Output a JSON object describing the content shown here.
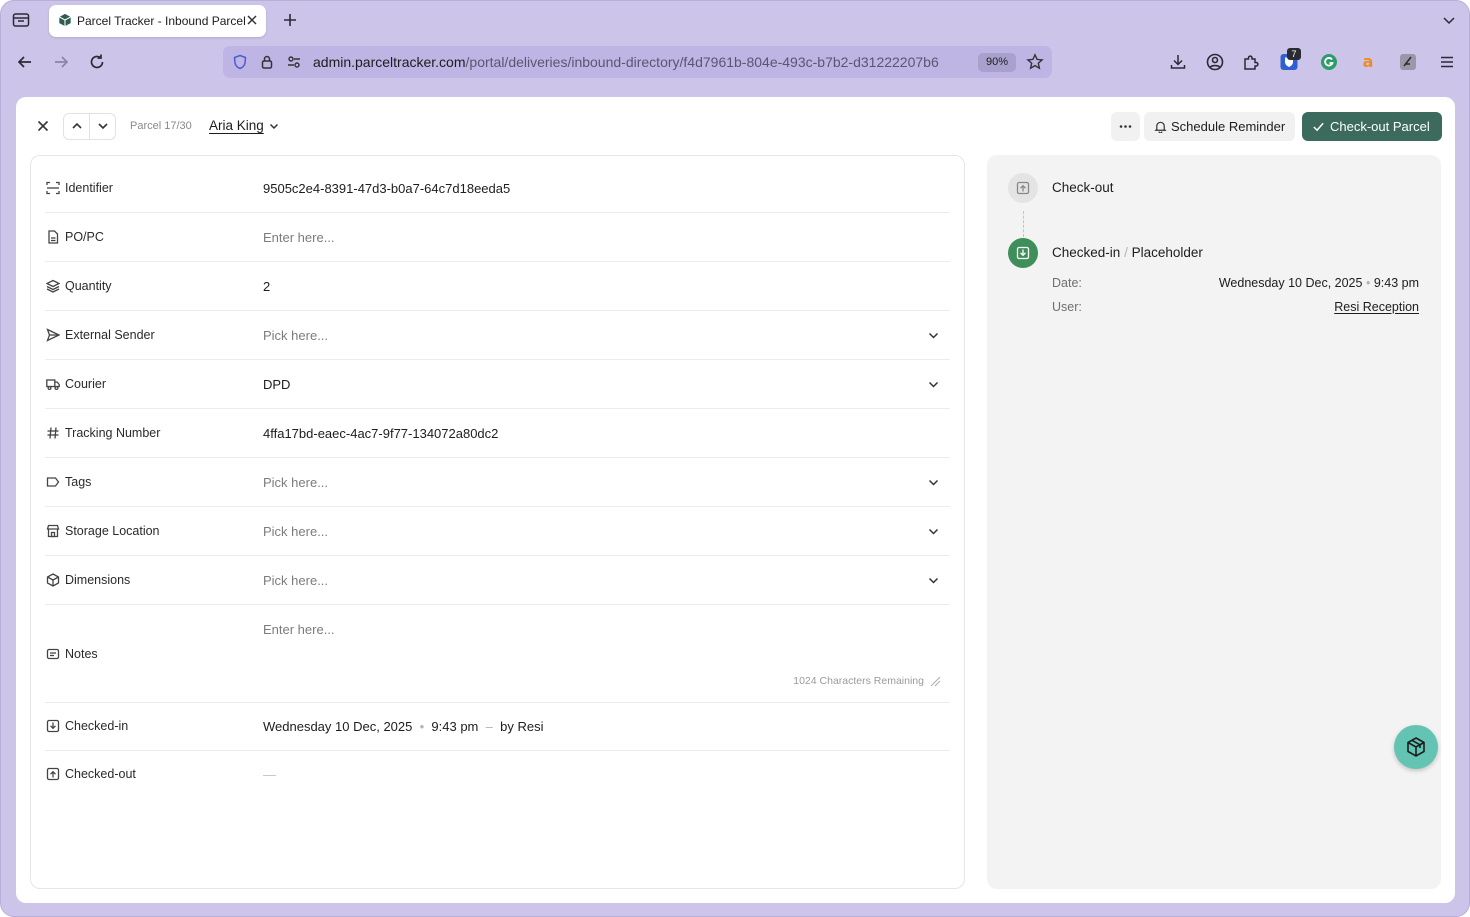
{
  "browser": {
    "tab_title": "Parcel Tracker - Inbound Parcels",
    "url_host": "admin.parceltracker.com",
    "url_path": "/portal/deliveries/inbound-directory/f4d7961b-804e-493c-b7b2-d31222207b6",
    "zoom": "90%",
    "extension_badge": "7"
  },
  "header": {
    "parcel_position": "Parcel 17/30",
    "recipient": "Aria King",
    "schedule_label": "Schedule Reminder",
    "checkout_label": "Check-out Parcel"
  },
  "form": {
    "identifier": {
      "label": "Identifier",
      "value": "9505c2e4-8391-47d3-b0a7-64c7d18eeda5"
    },
    "po_pc": {
      "label": "PO/PC",
      "placeholder": "Enter here..."
    },
    "quantity": {
      "label": "Quantity",
      "value": "2"
    },
    "external_sender": {
      "label": "External Sender",
      "placeholder": "Pick here..."
    },
    "courier": {
      "label": "Courier",
      "value": "DPD"
    },
    "tracking_number": {
      "label": "Tracking Number",
      "value": "4ffa17bd-eaec-4ac7-9f77-134072a80dc2"
    },
    "tags": {
      "label": "Tags",
      "placeholder": "Pick here..."
    },
    "storage_location": {
      "label": "Storage Location",
      "placeholder": "Pick here..."
    },
    "dimensions": {
      "label": "Dimensions",
      "placeholder": "Pick here..."
    },
    "notes": {
      "label": "Notes",
      "placeholder": "Enter here...",
      "chars_remaining": "1024 Characters Remaining"
    },
    "checked_in": {
      "label": "Checked-in",
      "date": "Wednesday 10 Dec, 2025",
      "time": "9:43 pm",
      "by": "by Resi"
    },
    "checked_out": {
      "label": "Checked-out",
      "value": "—"
    }
  },
  "timeline": {
    "checkout_title": "Check-out",
    "checkedin_title": "Checked-in",
    "checkedin_separator": "/",
    "checkedin_sub": "Placeholder",
    "date_label": "Date:",
    "date_value": "Wednesday 10 Dec, 2025",
    "time_value": "9:43 pm",
    "user_label": "User:",
    "user_value": "Resi Reception",
    "accent_color": "#3f8f5a"
  }
}
